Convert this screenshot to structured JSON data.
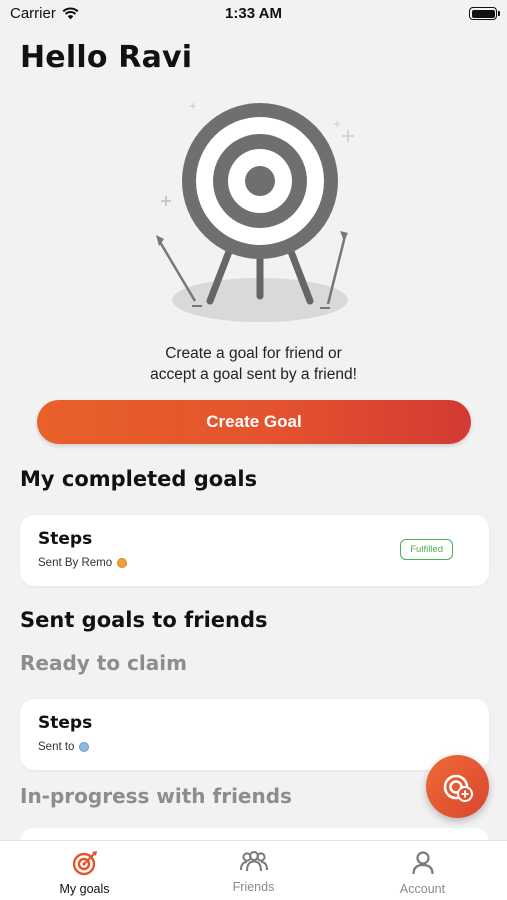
{
  "status_bar": {
    "carrier": "Carrier",
    "time": "1:33 AM"
  },
  "greeting": "Hello Ravi",
  "hero": {
    "line1": "Create a goal for friend or",
    "line2": "accept a goal sent by a friend!"
  },
  "create_button": "Create Goal",
  "completed": {
    "title": "My completed goals",
    "card": {
      "title": "Steps",
      "subtitle": "Sent By Remo",
      "badge": "Fulfilled"
    }
  },
  "sent": {
    "title": "Sent goals to friends",
    "ready_title": "Ready to claim",
    "card": {
      "title": "Steps",
      "subtitle": "Sent to"
    },
    "inprogress_title": "In-progress with friends"
  },
  "tabs": [
    {
      "label": "My goals",
      "icon": "target-icon",
      "active": true
    },
    {
      "label": "Friends",
      "icon": "friends-icon",
      "active": false
    },
    {
      "label": "Account",
      "icon": "account-icon",
      "active": false
    }
  ],
  "colors": {
    "accent": "#e4532e",
    "fulfilled": "#4caf50"
  }
}
